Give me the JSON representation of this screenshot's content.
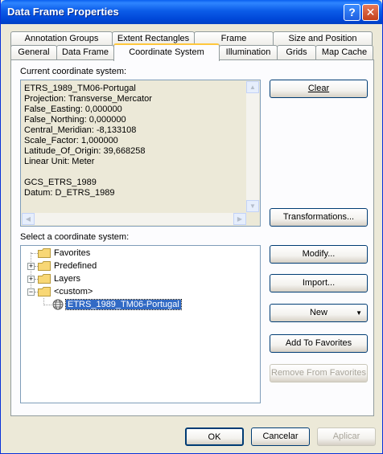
{
  "window": {
    "title": "Data Frame Properties",
    "help_glyph": "?",
    "close_glyph": "✕"
  },
  "tabs_back": [
    {
      "label": "Annotation Groups"
    },
    {
      "label": "Extent Rectangles"
    },
    {
      "label": "Frame"
    },
    {
      "label": "Size and Position"
    }
  ],
  "tabs_front": [
    {
      "label": "General"
    },
    {
      "label": "Data Frame"
    },
    {
      "label": "Coordinate System"
    },
    {
      "label": "Illumination"
    },
    {
      "label": "Grids"
    },
    {
      "label": "Map Cache"
    }
  ],
  "current": {
    "heading": "Current coordinate system:",
    "text": "ETRS_1989_TM06-Portugal\nProjection: Transverse_Mercator\nFalse_Easting: 0,000000\nFalse_Northing: 0,000000\nCentral_Meridian: -8,133108\nScale_Factor: 1,000000\nLatitude_Of_Origin: 39,668258\nLinear Unit: Meter\n\nGCS_ETRS_1989\nDatum: D_ETRS_1989"
  },
  "select": {
    "heading": "Select a coordinate system:",
    "tree": [
      {
        "label": "Favorites"
      },
      {
        "label": "Predefined"
      },
      {
        "label": "Layers"
      },
      {
        "label": "<custom>"
      },
      {
        "label": "ETRS_1989_TM06-Portugal"
      }
    ]
  },
  "buttons": {
    "clear": "Clear",
    "transformations": "Transformations...",
    "modify": "Modify...",
    "import": "Import...",
    "new": "New",
    "add_fav": "Add To Favorites",
    "remove_fav": "Remove From Favorites",
    "ok": "OK",
    "cancel": "Cancelar",
    "apply": "Aplicar"
  },
  "icons": [
    "help-icon",
    "close-icon",
    "folder-icon",
    "plus-icon",
    "minus-icon",
    "globe-icon",
    "arrow-left-icon",
    "arrow-right-icon",
    "arrow-up-icon",
    "arrow-down-icon",
    "dropdown-arrow-icon"
  ]
}
